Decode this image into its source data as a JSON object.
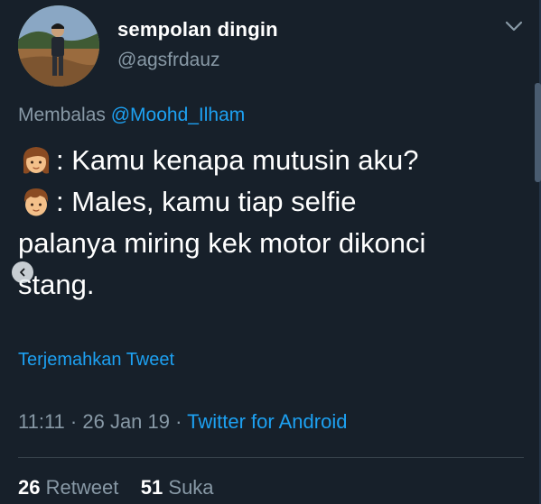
{
  "user": {
    "display_name": "sempolan dingin",
    "handle": "@agsfrdauz"
  },
  "reply": {
    "prefix": "Membalas",
    "mention": "@Moohd_Ilham"
  },
  "tweet": {
    "line1_text": ": Kamu kenapa mutusin aku?",
    "line2_text": ": Males, kamu tiap selfie",
    "line3_text": "palanya miring kek motor dikonci",
    "line4_text": "stang.",
    "line1_icon": "girl-emoji-icon",
    "line2_icon": "boy-emoji-icon"
  },
  "translate_label": "Terjemahkan Tweet",
  "meta": {
    "time": "11:11",
    "separator1": " · ",
    "date": "26 Jan 19",
    "separator2": " · ",
    "source": "Twitter for Android"
  },
  "stats": {
    "retweets_count": "26",
    "retweets_label": "Retweet",
    "likes_count": "51",
    "likes_label": "Suka"
  },
  "colors": {
    "background": "#17202a",
    "accent": "#1da1f2",
    "muted": "#8899a6"
  }
}
